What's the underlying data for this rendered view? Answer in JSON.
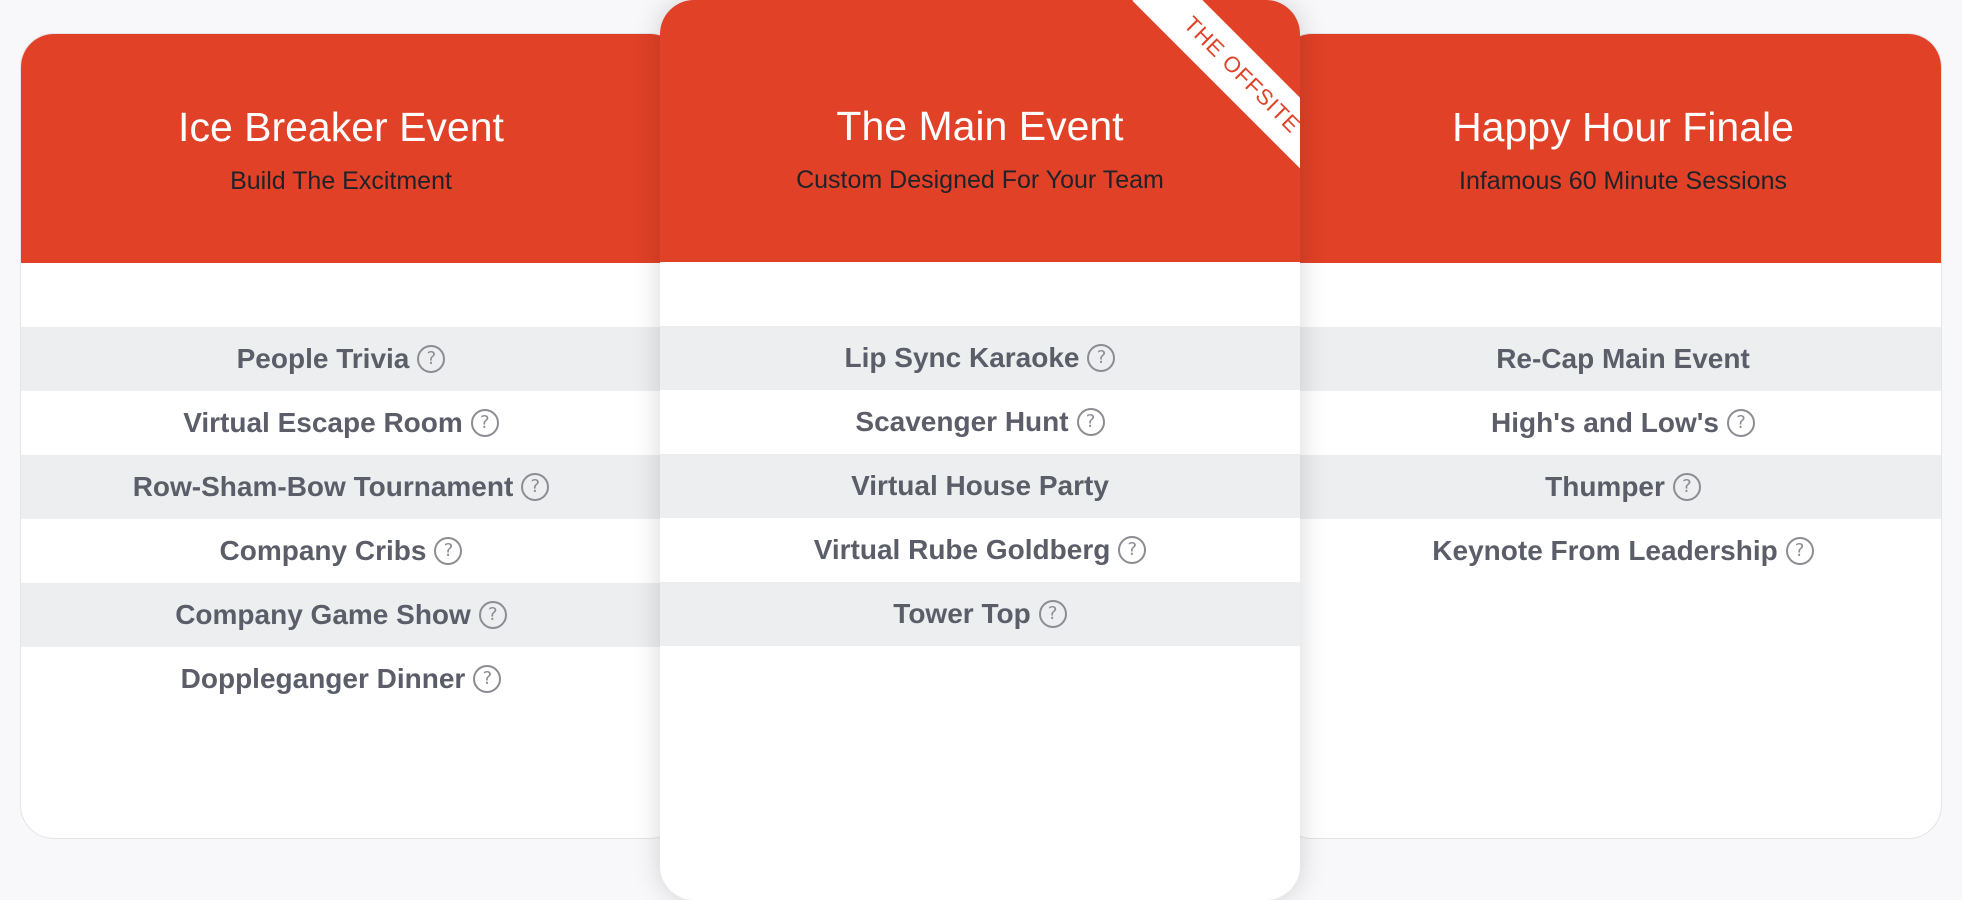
{
  "theme": {
    "accent": "#e04127",
    "stripe": "#edeef0",
    "text": "#5b5e68",
    "background": "#f8f7f9"
  },
  "cards": [
    {
      "title": "Ice Breaker Event",
      "subtitle": "Build The Excitment",
      "features": [
        {
          "label": "People Trivia",
          "help": true
        },
        {
          "label": "Virtual Escape Room",
          "help": true
        },
        {
          "label": "Row-Sham-Bow Tournament",
          "help": true
        },
        {
          "label": "Company Cribs",
          "help": true
        },
        {
          "label": "Company Game Show",
          "help": true
        },
        {
          "label": "Doppleganger Dinner",
          "help": true
        }
      ]
    },
    {
      "title": "The Main Event",
      "subtitle": "Custom Designed For Your Team",
      "ribbon": "THE OFFSITE",
      "features": [
        {
          "label": "Lip Sync Karaoke",
          "help": true
        },
        {
          "label": "Scavenger Hunt",
          "help": true
        },
        {
          "label": "Virtual House Party",
          "help": false
        },
        {
          "label": "Virtual Rube Goldberg",
          "help": true
        },
        {
          "label": "Tower Top",
          "help": true
        }
      ]
    },
    {
      "title": "Happy Hour Finale",
      "subtitle": "Infamous 60 Minute Sessions",
      "features": [
        {
          "label": "Re-Cap Main Event",
          "help": false
        },
        {
          "label": "High's and Low's",
          "help": true
        },
        {
          "label": "Thumper",
          "help": true
        },
        {
          "label": "Keynote From Leadership",
          "help": true
        }
      ]
    }
  ],
  "icons": {
    "help": "?"
  }
}
